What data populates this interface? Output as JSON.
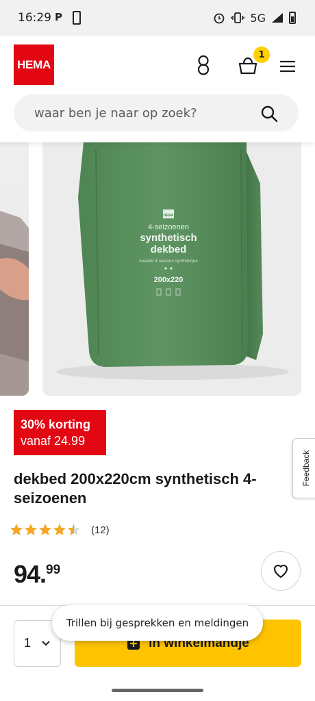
{
  "status_bar": {
    "time": "16:29",
    "notif_letter": "P",
    "network": "5G"
  },
  "header": {
    "logo_text": "HEMA",
    "cart_count": "1",
    "icons": [
      "account-icon",
      "basket-icon",
      "menu-icon"
    ]
  },
  "search": {
    "placeholder": "waar ben je naar op zoek?"
  },
  "product_image": {
    "bag_brand": "HEMA",
    "bag_line1": "4-seizoenen",
    "bag_line2": "synthetisch",
    "bag_line3": "dekbed",
    "bag_line4": "couette 4 saisons synthétique",
    "bag_size": "200x220"
  },
  "promo": {
    "line1": "30% korting",
    "line2": "vanaf 24.99"
  },
  "feedback": {
    "label": "Feedback"
  },
  "product": {
    "title": "dekbed 200x220cm synthetisch 4-seizoenen",
    "rating": 4.5,
    "rating_max": 5,
    "review_count": "(12)",
    "price_int": "94.",
    "price_dec": "99"
  },
  "cart_bar": {
    "quantity": "1",
    "add_label": "in winkelmandje"
  },
  "toast": {
    "message": "Trillen bij gesprekken en meldingen"
  },
  "colors": {
    "brand_red": "#e30613",
    "cta_yellow": "#ffc300",
    "badge_yellow": "#ffd100",
    "star_orange": "#f5a623",
    "bag_green": "#5a8f5c"
  }
}
